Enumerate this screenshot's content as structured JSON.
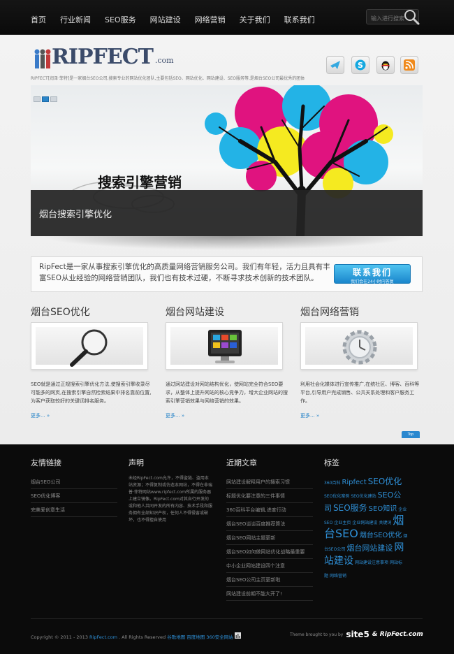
{
  "nav": {
    "items": [
      "首页",
      "行业新闻",
      "SEO服务",
      "网站建设",
      "网络营销",
      "关于我们",
      "联系我们"
    ],
    "search_placeholder": "输入进行搜索"
  },
  "header": {
    "logo_text": "RIPFECT",
    "logo_suffix": ".com",
    "tagline": "RIPFECT[润泽·菲特]是一家烟台SEO公司,搜索专业的网站优化团队,主要包括SEO、网站优化、网站建设、SEO服务等,是烟台SEO公司最优秀的团体"
  },
  "social_icons": [
    "twitter-bird-icon",
    "skype-icon",
    "qq-penguin-icon",
    "rss-icon"
  ],
  "banner": {
    "title": "搜索引擎营销",
    "caption": "烟台搜索引擎优化",
    "slides": 3,
    "active_slide": 2
  },
  "intro": {
    "text": "RipFect是一家从事搜索引擎优化的高质量网络营销服务公司。我们有年轻，活力且具有丰富SEO从业经验的网络营销团队，我们也有技术过硬，不断寻求技术创新的技术团队。",
    "contact_label": "联系我们",
    "contact_sub": "我们会在24小时内答复"
  },
  "services": [
    {
      "title": "烟台SEO优化",
      "desc": "SEO就是通过正规搜索引擎优化方法,使搜索引擎收录尽可能多的网页,在搜索引擎自然检索结果中排名靠前位置,为客户获取较好的关键词排名服务。",
      "more": "更多... »"
    },
    {
      "title": "烟台网站建设",
      "desc": "通过网站建设对网站结构优化，使网站完全符合SEO要求，从整体上提升网站的核心竞争力，增大企业网站的搜索引擎营销效果与网络营销的效果。",
      "more": "更多... »"
    },
    {
      "title": "烟台网络营销",
      "desc": "利用社会化媒体进行宣传推广,在统社区、博客、百科等平台,引导用户完成销售、公共关系处理和客户服务工作。",
      "more": "更多... »"
    }
  ],
  "top_link": "Top",
  "footer": {
    "friend_links_title": "友情链接",
    "friend_links": [
      "烟台SEO公司",
      "SEO优化博客",
      "完美爱创意生活"
    ],
    "statement_title": "声明",
    "statement_text": "未经RipFect.com允许，不得盗链、盗用本站资源；不得复制或仿造本网站，不得在非瑞普·菲特网站www.ripfect.com所属的服务器上建立镜像。RipFect.com对其自行开发的或和他人共同开发的所有内容、技术手段和服务拥有全部知识产权，任何人不得侵害或破坏，也不得擅自使用",
    "recent_title": "近期文章",
    "recent_posts": [
      "网站建设解释用户的搜索习惯",
      "标题优化要注意的三件事情",
      "360百科平台编辑,进度行动",
      "烟台SEO谈谈百度推荐算法",
      "烟台SEO网站主题更新",
      "烟台SEO如何做网站优化战略最重要",
      "中小企业网站建设四个注意",
      "烟台SEO公司主页更新啦",
      "网站建设前期不能大开了!"
    ],
    "tags_title": "标签",
    "tags": [
      {
        "t": "360百科",
        "s": 6
      },
      {
        "t": "Ripfect",
        "s": 10
      },
      {
        "t": "SEO优化",
        "s": 12
      },
      {
        "t": "SEO优化案例",
        "s": 6
      },
      {
        "t": "SEO优化建站",
        "s": 6
      },
      {
        "t": "SEO公司",
        "s": 11
      },
      {
        "t": "SEO服务",
        "s": 12
      },
      {
        "t": "SEO知识",
        "s": 10
      },
      {
        "t": "企业SEO",
        "s": 6
      },
      {
        "t": "企业主页",
        "s": 6
      },
      {
        "t": "企业网站建设",
        "s": 6
      },
      {
        "t": "关键词",
        "s": 6
      },
      {
        "t": "烟台SEO",
        "s": 16
      },
      {
        "t": "烟台SEO优化",
        "s": 10
      },
      {
        "t": "烟台SEO公司",
        "s": 6
      },
      {
        "t": "烟台网站建设",
        "s": 11
      },
      {
        "t": "网站建设",
        "s": 14
      },
      {
        "t": "网站建设注意事项",
        "s": 6
      },
      {
        "t": "网站标题",
        "s": 6
      },
      {
        "t": "网络营销",
        "s": 6
      }
    ],
    "copyright_prefix": "Copyright © 2011 - 2013",
    "copyright_site": "RipFect.com",
    "copyright_rights": ". All Rights Reserved",
    "copyright_links": "谷歌地图 百度地图 360安全网站",
    "theme_by": "Theme brought to you by",
    "theme_brand": "site5",
    "theme_partner": "& RipFect.com"
  }
}
